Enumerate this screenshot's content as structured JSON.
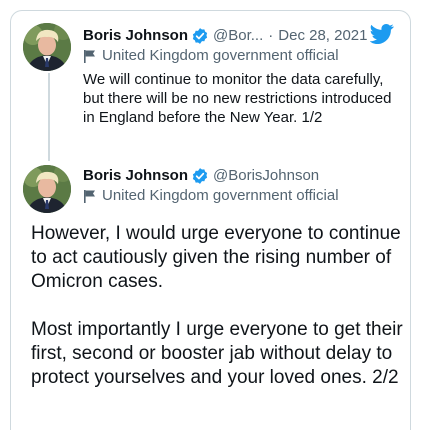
{
  "tweet1": {
    "author_name": "Boris Johnson",
    "handle": "@Bor...",
    "separator": "·",
    "date": "Dec 28, 2021",
    "label": "United Kingdom government official",
    "text": "We will continue to monitor the data carefully, but there will be no new restrictions introduced in England before the New Year. 1/2"
  },
  "tweet2": {
    "author_name": "Boris Johnson",
    "handle": "@BorisJohnson",
    "label": "United Kingdom government official",
    "paragraphs": [
      "However, I would urge everyone to continue to act cautiously given the rising number of Omicron cases.",
      "Most importantly I urge everyone to get their first, second or booster jab without delay to protect yourselves and your loved ones. 2/2"
    ]
  },
  "icons": {
    "verified": "verified-badge-icon",
    "label_flag": "government-flag-icon",
    "brand": "twitter-bird-icon"
  },
  "colors": {
    "verified": "#1d9bf0",
    "brand": "#1d9bf0",
    "secondary_text": "#536471",
    "primary_text": "#0f1419"
  }
}
